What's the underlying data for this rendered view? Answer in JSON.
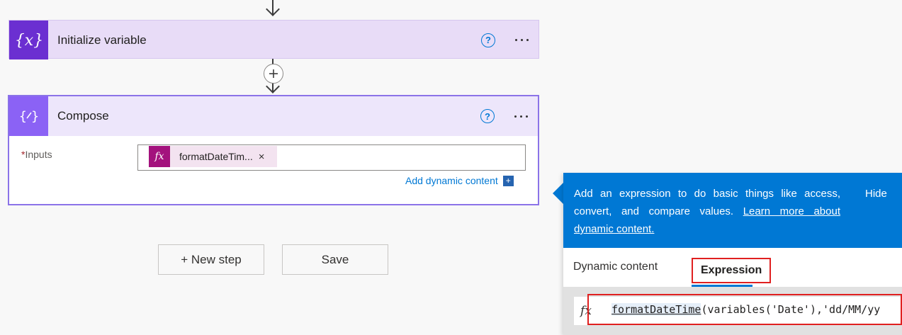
{
  "flow": {
    "init_step": {
      "title": "Initialize variable",
      "icon": "curly-braces-x-icon",
      "accent": "#6b2fd1"
    },
    "compose_step": {
      "title": "Compose",
      "icon": "compose-icon",
      "accent": "#8b62f5",
      "inputs_required_mark": "*",
      "inputs_label": "Inputs",
      "token_label": "formatDateTim...",
      "token_remove": "×",
      "add_dynamic_label": "Add dynamic content"
    },
    "new_step_label": "+ New step",
    "save_label": "Save"
  },
  "popup": {
    "banner_text": "Add an expression to do basic things like access, convert, and compare values.",
    "banner_link": "Learn more about dynamic content.",
    "hide_label": "Hide",
    "tabs": [
      {
        "label": "Dynamic content",
        "active": false
      },
      {
        "label": "Expression",
        "active": true
      }
    ],
    "expression_fn": "formatDateTime",
    "expression_rest": "(variables('Date'),'dd/MM/yy"
  }
}
